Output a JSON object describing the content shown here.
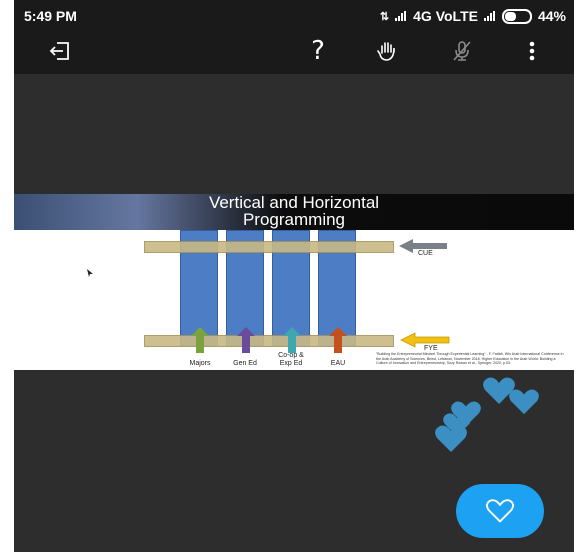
{
  "status_bar": {
    "time": "5:49 PM",
    "network": "4G VoLTE",
    "battery": "44%"
  },
  "toolbar": {
    "icons": [
      "exit-icon",
      "help-icon",
      "raise-hand-icon",
      "mic-off-icon",
      "more-options-icon"
    ],
    "help_glyph": "?"
  },
  "slide": {
    "title_line1": "Vertical and Horizontal",
    "title_line2": "Programming",
    "band_top_label": "CUE",
    "band_bottom_label": "FYE",
    "columns": [
      "Majors",
      "Gen Ed",
      "Co-op & Exp Ed",
      "EAU"
    ],
    "column_line1": [
      "Majors",
      "Gen Ed",
      "Co-op &",
      "EAU"
    ],
    "column_line2": [
      "",
      "",
      "Exp Ed",
      ""
    ],
    "arrow_colors": [
      "#7aa23f",
      "#6a4c9c",
      "#3fa7b0",
      "#c2511f"
    ],
    "reference": "\"Building the Entrepreneurial Mindset Through Experiential Learning\" - F. Fattah, Win Arab International Conference in the Arab Academy of Sciences, Beirut, Lebanon, November 2018. Higher Education in the Arab World: Building a Culture of Innovation and Entrepreneurship, Suzy Rowan et al., Springer, 2020, p.53."
  },
  "colors": {
    "accent": "#1da1f2",
    "heart": "#3b8fc2",
    "column": "#4d7dc5",
    "band": "#c9b986"
  }
}
